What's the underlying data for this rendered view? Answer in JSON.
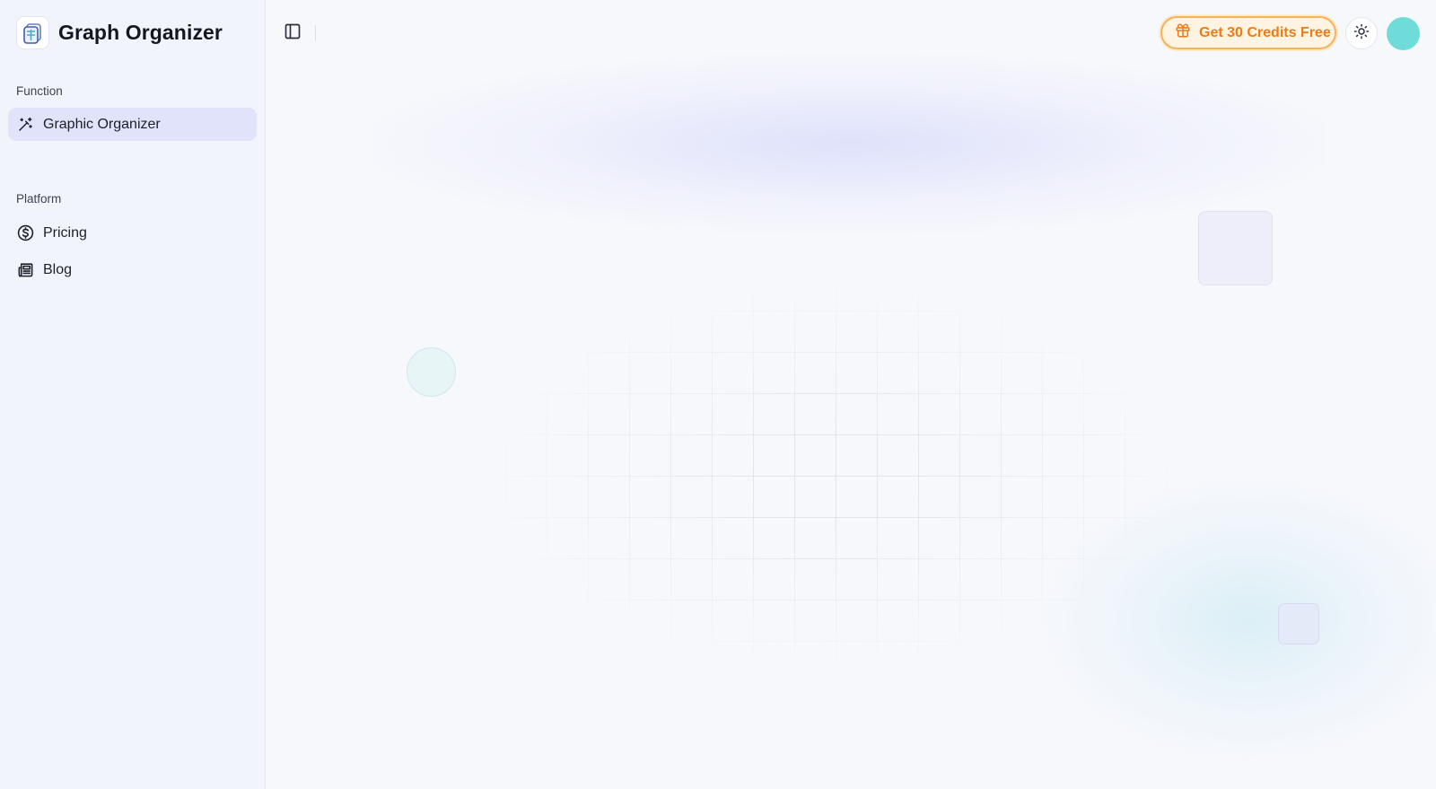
{
  "brand": {
    "name": "Graph Organizer",
    "logo_icon": "graph-organizer-logo"
  },
  "sidebar": {
    "sections": [
      {
        "label": "Function",
        "items": [
          {
            "label": "Graphic Organizer",
            "icon": "magic-wand-icon",
            "active": true
          }
        ]
      },
      {
        "label": "Platform",
        "items": [
          {
            "label": "Pricing",
            "icon": "dollar-circle-icon",
            "active": false
          },
          {
            "label": "Blog",
            "icon": "newspaper-icon",
            "active": false
          }
        ]
      }
    ]
  },
  "header": {
    "sidebar_toggle_icon": "sidebar-toggle-icon",
    "credits_button": {
      "label": "Get 30 Credits Free",
      "icon": "gift-icon"
    },
    "theme_toggle_icon": "sun-icon"
  },
  "colors": {
    "accent_active_bg": "#e0e3fa",
    "credits_border": "#f6b15c",
    "credits_text": "#ee7b14",
    "avatar": "#6fdcd9",
    "page_bg": "#f7f8fc",
    "sidebar_bg": "#f2f4fb"
  }
}
